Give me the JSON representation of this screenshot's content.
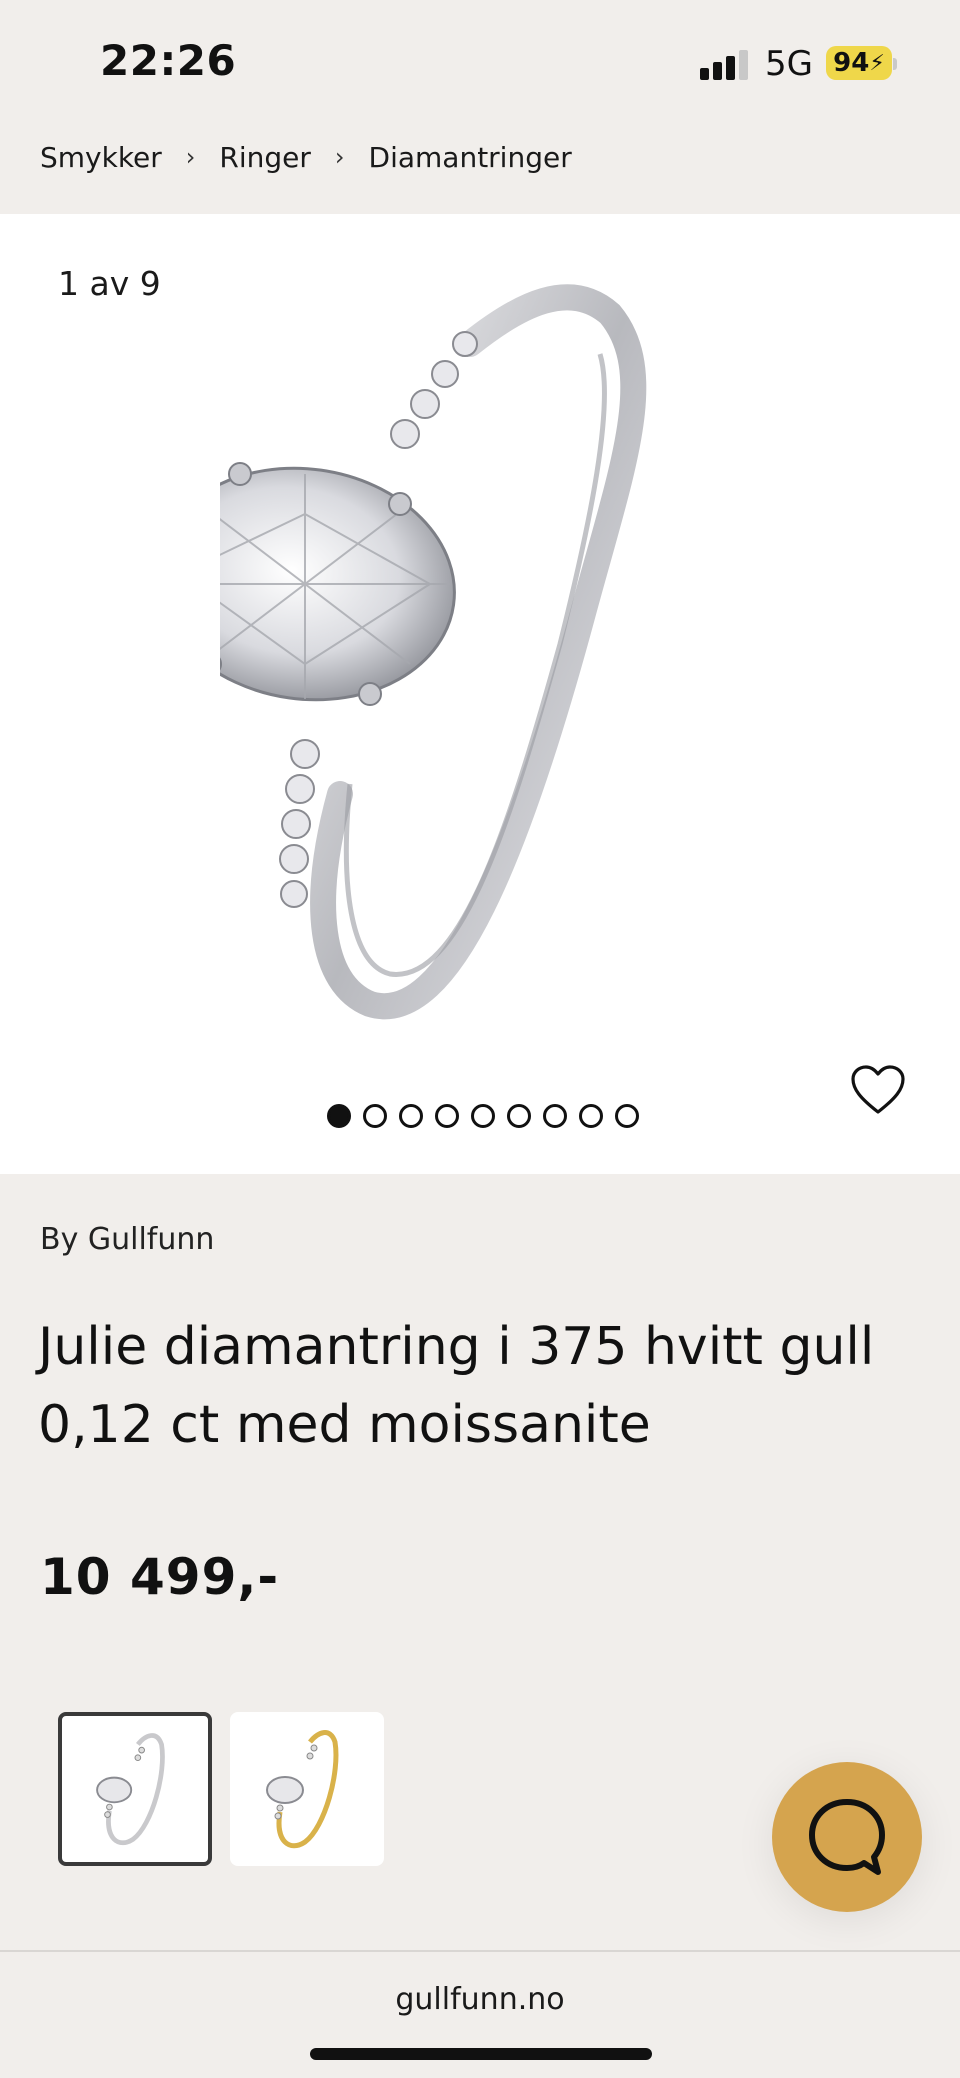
{
  "status_bar": {
    "time": "22:26",
    "network": "5G",
    "battery": "94"
  },
  "breadcrumb": {
    "items": [
      "Smykker",
      "Ringer",
      "Diamantringer"
    ],
    "separator": ">"
  },
  "gallery": {
    "counter": "1 av 9",
    "current_index": 1,
    "total": 9
  },
  "product": {
    "brand": "By Gullfunn",
    "title": "Julie diamantring i 375 hvitt gull 0,12 ct med moissanite",
    "price": "10 499,-"
  },
  "variants": [
    {
      "name": "white-gold",
      "selected": true,
      "color": "#c9c9cc"
    },
    {
      "name": "yellow-gold",
      "selected": false,
      "color": "#d9b24a"
    }
  ],
  "chat": {
    "color": "#d5a44e"
  },
  "browser": {
    "url": "gullfunn.no"
  }
}
